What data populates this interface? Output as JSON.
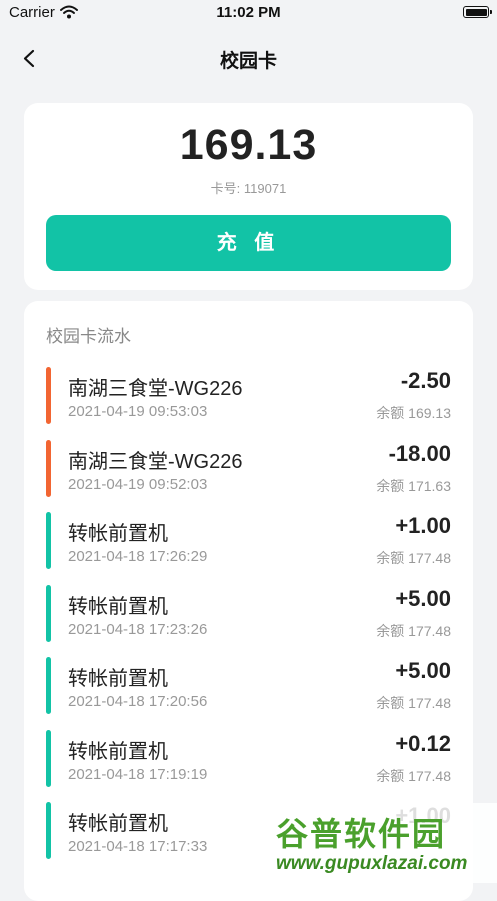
{
  "status_bar": {
    "carrier": "Carrier",
    "time": "11:02 PM"
  },
  "nav": {
    "title": "校园卡"
  },
  "card": {
    "balance": "169.13",
    "card_no_label": "卡号: 119071",
    "recharge_label": "充 值"
  },
  "list": {
    "title": "校园卡流水",
    "items": [
      {
        "name": "南湖三食堂-WG226",
        "datetime": "2021-04-19 09:53:03",
        "amount": "-2.50",
        "balance": "余额 169.13",
        "type": "expense"
      },
      {
        "name": "南湖三食堂-WG226",
        "datetime": "2021-04-19 09:52:03",
        "amount": "-18.00",
        "balance": "余额 171.63",
        "type": "expense"
      },
      {
        "name": "转帐前置机",
        "datetime": "2021-04-18 17:26:29",
        "amount": "+1.00",
        "balance": "余额 177.48",
        "type": "income"
      },
      {
        "name": "转帐前置机",
        "datetime": "2021-04-18 17:23:26",
        "amount": "+5.00",
        "balance": "余额 177.48",
        "type": "income"
      },
      {
        "name": "转帐前置机",
        "datetime": "2021-04-18 17:20:56",
        "amount": "+5.00",
        "balance": "余额 177.48",
        "type": "income"
      },
      {
        "name": "转帐前置机",
        "datetime": "2021-04-18 17:19:19",
        "amount": "+0.12",
        "balance": "余额 177.48",
        "type": "income"
      },
      {
        "name": "转帐前置机",
        "datetime": "2021-04-18 17:17:33",
        "amount": "+1.00",
        "balance": "",
        "type": "income"
      }
    ]
  },
  "colors": {
    "expense": "#f26532",
    "income": "#12c3a6",
    "accent": "#12c3a6"
  },
  "watermark": {
    "main": "谷普软件园",
    "url": "www.gupuxlazai.com"
  }
}
